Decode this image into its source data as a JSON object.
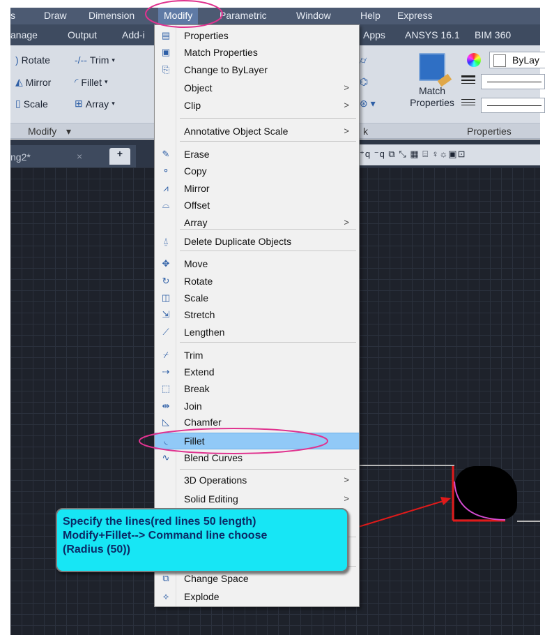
{
  "menubar": {
    "items": [
      "s",
      "Draw",
      "Dimension",
      "Modify",
      "Parametric",
      "Window",
      "Help",
      "Express"
    ]
  },
  "ribbon_tabs": {
    "items": [
      "anage",
      "Output",
      "Add-i",
      "Apps",
      "ANSYS 16.1",
      "BIM 360"
    ]
  },
  "ribbon": {
    "rotate": "Rotate",
    "trim": "Trim",
    "mirror": "Mirror",
    "fillet": "Fillet",
    "scale": "Scale",
    "array": "Array",
    "modify_panel": "Modify",
    "match_properties_line1": "Match",
    "match_properties_line2": "Properties",
    "bylayer": "ByLay",
    "properties_panel": "Properties",
    "view_panel_fragment": "k"
  },
  "file_tab": {
    "name": "ng2*"
  },
  "dropdown": {
    "items": [
      {
        "label": "Properties",
        "icon": "properties-icon",
        "glyph": "▤"
      },
      {
        "label": "Match Properties",
        "icon": "match-properties-icon",
        "glyph": "▣"
      },
      {
        "label": "Change to ByLayer",
        "icon": "change-bylayer-icon",
        "glyph": "⎘"
      },
      {
        "label": "Object",
        "submenu": true
      },
      {
        "label": "Clip",
        "submenu": true
      },
      {
        "label": "Annotative Object Scale",
        "submenu": true
      },
      {
        "label": "Erase",
        "icon": "eraser-icon",
        "glyph": "✎"
      },
      {
        "label": "Copy",
        "icon": "copy-icon",
        "glyph": "⚬"
      },
      {
        "label": "Mirror",
        "icon": "mirror-icon",
        "glyph": "⩘"
      },
      {
        "label": "Offset",
        "icon": "offset-icon",
        "glyph": "⌓"
      },
      {
        "label": "Array",
        "submenu": true
      },
      {
        "label": "Delete Duplicate Objects",
        "icon": "delete-duplicates-icon",
        "glyph": "⍙"
      },
      {
        "label": "Move",
        "icon": "move-icon",
        "glyph": "✥"
      },
      {
        "label": "Rotate",
        "icon": "rotate-icon",
        "glyph": "↻"
      },
      {
        "label": "Scale",
        "icon": "scale-icon",
        "glyph": "◫"
      },
      {
        "label": "Stretch",
        "icon": "stretch-icon",
        "glyph": "⇲"
      },
      {
        "label": "Lengthen",
        "icon": "lengthen-icon",
        "glyph": "⟋"
      },
      {
        "label": "Trim",
        "icon": "trim-icon",
        "glyph": "⌿"
      },
      {
        "label": "Extend",
        "icon": "extend-icon",
        "glyph": "⇢"
      },
      {
        "label": "Break",
        "icon": "break-icon",
        "glyph": "⬚"
      },
      {
        "label": "Join",
        "icon": "join-icon",
        "glyph": "⇹"
      },
      {
        "label": "Chamfer",
        "icon": "chamfer-icon",
        "glyph": "◺"
      },
      {
        "label": "Fillet",
        "icon": "fillet-icon",
        "glyph": "◟"
      },
      {
        "label": "Blend Curves",
        "icon": "blend-curves-icon",
        "glyph": "∿"
      },
      {
        "label": "3D Operations",
        "submenu": true
      },
      {
        "label": "Solid Editing",
        "submenu": true
      },
      {
        "label": "Change Space",
        "icon": "change-space-icon",
        "glyph": "⧉"
      },
      {
        "label": "Explode",
        "icon": "explode-icon",
        "glyph": "⟡"
      }
    ],
    "submenu_glyph": ">"
  },
  "callout": {
    "line1": "Specify the lines(red lines 50 length)",
    "line2": "Modify+Fillet--> Command line choose",
    "line3": "(Radius (50))"
  },
  "colors": {
    "annotation_ellipse": "#e0338f",
    "arrow": "#e01a1a",
    "callout_fill": "#17e6f5",
    "highlight": "#91c9f7",
    "fillet_arc": "#d34bd0"
  }
}
